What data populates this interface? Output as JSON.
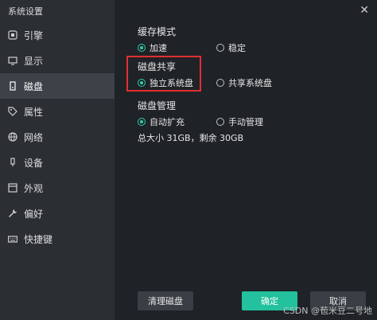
{
  "window": {
    "title": "系统设置",
    "close_glyph": "✕"
  },
  "sidebar": {
    "items": [
      {
        "label": "引擎",
        "icon": "engine-icon"
      },
      {
        "label": "显示",
        "icon": "monitor-icon"
      },
      {
        "label": "磁盘",
        "icon": "disk-icon",
        "active": true
      },
      {
        "label": "属性",
        "icon": "tag-icon"
      },
      {
        "label": "网络",
        "icon": "globe-icon"
      },
      {
        "label": "设备",
        "icon": "device-icon"
      },
      {
        "label": "外观",
        "icon": "appearance-icon"
      },
      {
        "label": "偏好",
        "icon": "wrench-icon"
      },
      {
        "label": "快捷键",
        "icon": "keyboard-icon"
      }
    ]
  },
  "cache_mode": {
    "title": "缓存模式",
    "options": [
      "加速",
      "稳定"
    ],
    "selected": "加速"
  },
  "disk_share": {
    "title": "磁盘共享",
    "options": [
      "独立系统盘",
      "共享系统盘"
    ],
    "selected": "独立系统盘"
  },
  "disk_manage": {
    "title": "磁盘管理",
    "options": [
      "自动扩充",
      "手动管理"
    ],
    "selected": "自动扩充",
    "size_info": "总大小 31GB，剩余 30GB"
  },
  "buttons": {
    "clean": "清理磁盘",
    "ok": "确定",
    "cancel": "取消"
  },
  "watermark": "CSDN @苞米豆二号地",
  "colors": {
    "accent": "#23c19d",
    "highlight": "#e03030"
  }
}
